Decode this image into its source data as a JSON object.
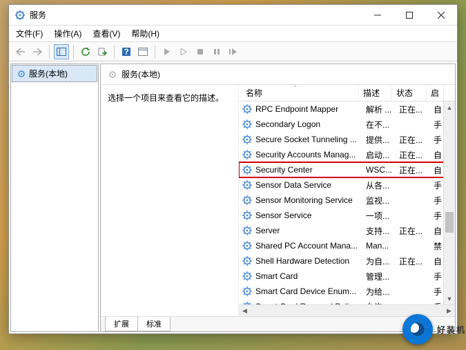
{
  "window": {
    "title": "服务"
  },
  "menu": {
    "file": "文件(F)",
    "action": "操作(A)",
    "view": "查看(V)",
    "help": "帮助(H)"
  },
  "tree": {
    "root": "服务(本地)"
  },
  "heading": "服务(本地)",
  "desc_prompt": "选择一个项目来查看它的描述。",
  "columns": {
    "name": "名称",
    "desc": "描述",
    "status": "状态",
    "startup": "启"
  },
  "highlighted_service": "Security Center",
  "services": [
    {
      "name": "RPC Endpoint Mapper",
      "desc": "解析 ...",
      "status": "正在...",
      "startup": "自"
    },
    {
      "name": "Secondary Logon",
      "desc": "在不...",
      "status": "",
      "startup": "手"
    },
    {
      "name": "Secure Socket Tunneling ...",
      "desc": "提供...",
      "status": "正在...",
      "startup": "手"
    },
    {
      "name": "Security Accounts Manag...",
      "desc": "启动...",
      "status": "正在...",
      "startup": "自"
    },
    {
      "name": "Security Center",
      "desc": "WSC...",
      "status": "正在...",
      "startup": "自"
    },
    {
      "name": "Sensor Data Service",
      "desc": "从各...",
      "status": "",
      "startup": "手"
    },
    {
      "name": "Sensor Monitoring Service",
      "desc": "监视...",
      "status": "",
      "startup": "手"
    },
    {
      "name": "Sensor Service",
      "desc": "一项...",
      "status": "",
      "startup": "手"
    },
    {
      "name": "Server",
      "desc": "支持...",
      "status": "正在...",
      "startup": "自"
    },
    {
      "name": "Shared PC Account Mana...",
      "desc": "Man...",
      "status": "",
      "startup": "禁"
    },
    {
      "name": "Shell Hardware Detection",
      "desc": "为自...",
      "status": "正在...",
      "startup": "自"
    },
    {
      "name": "Smart Card",
      "desc": "管理...",
      "status": "",
      "startup": "手"
    },
    {
      "name": "Smart Card Device Enum...",
      "desc": "为给...",
      "status": "",
      "startup": "手"
    },
    {
      "name": "Smart Card Removal Poli...",
      "desc": "允许...",
      "status": "",
      "startup": "手"
    }
  ],
  "tabs": {
    "extended": "扩展",
    "standard": "标准"
  },
  "watermark": "好装机"
}
